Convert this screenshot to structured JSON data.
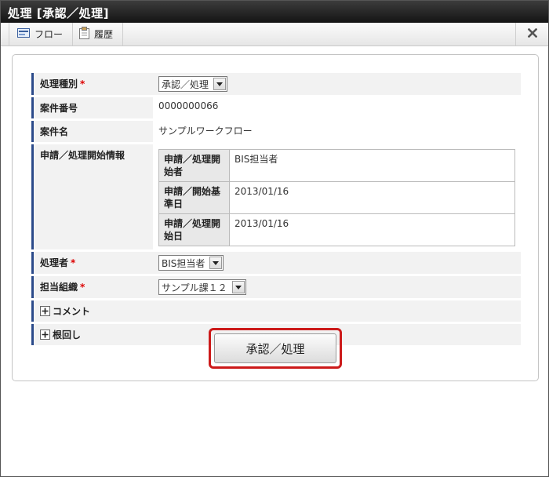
{
  "window": {
    "title": "処理 [承認／処理]"
  },
  "toolbar": {
    "flow_label": "フロー",
    "history_label": "履歴"
  },
  "form": {
    "process_type": {
      "label": "処理種別",
      "required_mark": "*",
      "value": "承認／処理"
    },
    "case_number": {
      "label": "案件番号",
      "value": "0000000066"
    },
    "case_name": {
      "label": "案件名",
      "value": "サンプルワークフロー"
    },
    "start_info": {
      "label": "申請／処理開始情報",
      "rows": [
        {
          "label": "申請／処理開始者",
          "value": "BIS担当者"
        },
        {
          "label": "申請／開始基準日",
          "value": "2013/01/16"
        },
        {
          "label": "申請／処理開始日",
          "value": "2013/01/16"
        }
      ]
    },
    "processor": {
      "label": "処理者",
      "required_mark": "*",
      "value": "BIS担当者"
    },
    "org": {
      "label": "担当組織",
      "required_mark": "*",
      "value": "サンプル課１２"
    },
    "comment": {
      "label": "コメント"
    },
    "nemawashi": {
      "label": "根回し"
    }
  },
  "submit_label": "承認／処理"
}
